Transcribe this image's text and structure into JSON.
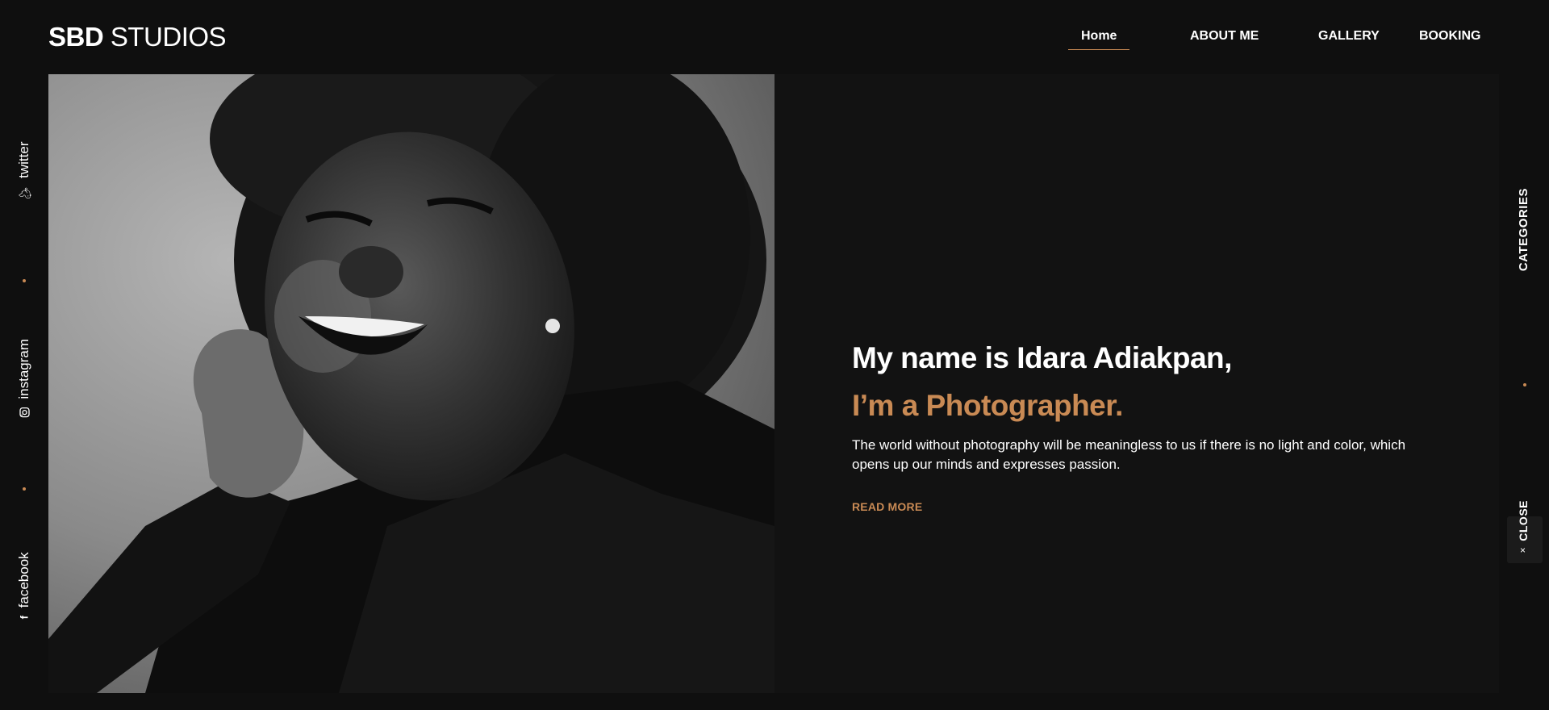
{
  "header": {
    "logo_bold": "SBD",
    "logo_light": "STUDIOS",
    "nav": {
      "home": "Home",
      "about": "ABOUT ME",
      "gallery": "GALLERY",
      "booking": "BOOKING"
    },
    "active_nav": "Home"
  },
  "hero": {
    "title": "My name is Idara Adiakpan,",
    "subtitle": "I’m a Photographer.",
    "description": "The world without photography will be meaningless to us if there is no light and color, which opens up our minds and expresses passion.",
    "read_more": "READ MORE"
  },
  "socials": [
    {
      "label": "twitter",
      "icon": "twitter-bird-icon"
    },
    {
      "label": "instagram",
      "icon": "instagram-icon"
    },
    {
      "label": "facebook",
      "icon": "facebook-icon"
    }
  ],
  "right_rail": {
    "categories": "CATEGORIES",
    "close": "CLOSE",
    "close_symbol": "×"
  },
  "colors": {
    "accent": "#c98a54",
    "background": "#0f0f0f",
    "panel": "#121212",
    "text": "#ffffff"
  }
}
